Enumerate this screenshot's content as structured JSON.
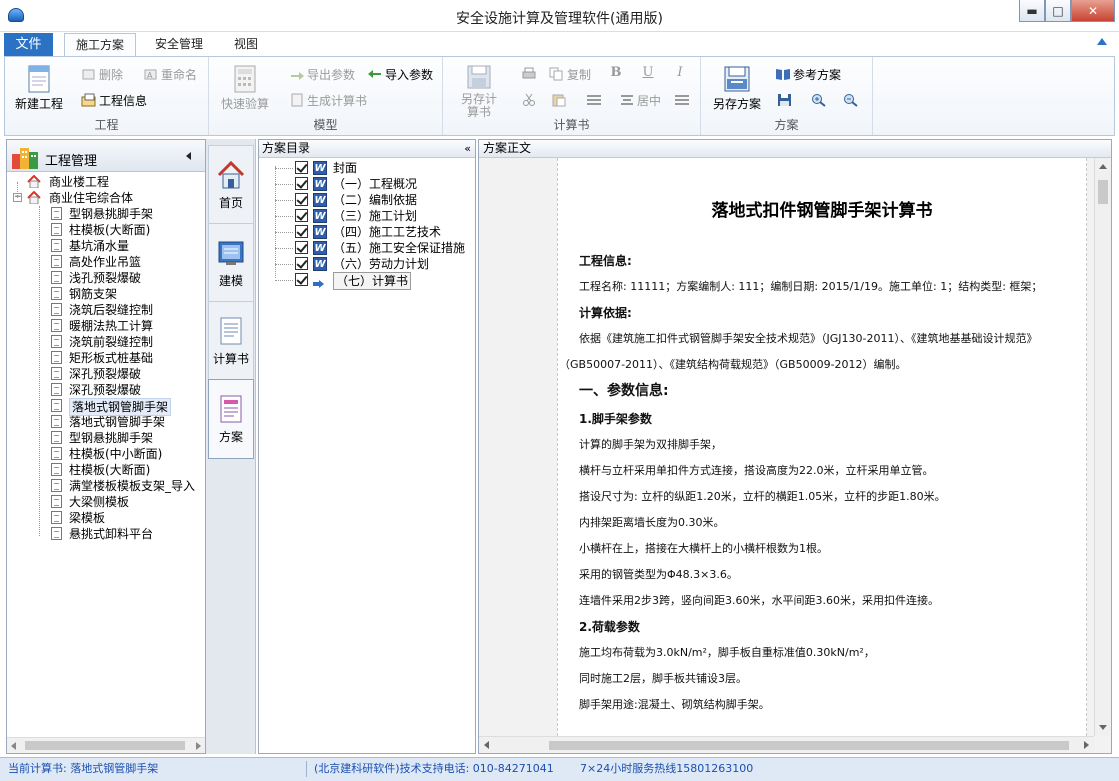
{
  "window": {
    "title": "安全设施计算及管理软件(通用版)",
    "min": "▬",
    "max": "□",
    "close": "✕"
  },
  "menu": {
    "file": "文件",
    "tabs": [
      "施工方案",
      "安全管理",
      "视图"
    ]
  },
  "ribbon": {
    "groups": {
      "project": "工程",
      "model": "模型",
      "calc": "计算书",
      "plan": "方案"
    },
    "new_project": "新建工程",
    "delete": "删除",
    "rename": "重命名",
    "project_info": "工程信息",
    "quick_check": "快速验算",
    "export_params": "导出参数",
    "import_params": "导入参数",
    "gen_calc": "生成计算书",
    "save_calc_as": "另存计算书",
    "copy": "复制",
    "bold": "B",
    "underline": "U",
    "italic": "I",
    "center": "居中",
    "save_plan_as": "另存方案",
    "ref_plan": "参考方案"
  },
  "left_panel": {
    "title": "工程管理",
    "projects": [
      {
        "name": "商业楼工程",
        "items": []
      },
      {
        "name": "商业住宅综合体",
        "items": [
          "型钢悬挑脚手架",
          "柱模板(大断面)",
          "基坑涌水量",
          "高处作业吊篮",
          "浅孔预裂爆破",
          "钢筋支架",
          "浇筑后裂缝控制",
          "暖棚法热工计算",
          "浇筑前裂缝控制",
          "矩形板式桩基础",
          "深孔预裂爆破",
          "深孔预裂爆破",
          "落地式钢管脚手架",
          "落地式钢管脚手架",
          "型钢悬挑脚手架",
          "柱模板(中小断面)",
          "柱模板(大断面)",
          "满堂楼板模板支架_导入",
          "大梁侧模板",
          "梁模板",
          "悬挑式卸料平台"
        ]
      }
    ],
    "selected_index": 12,
    "expand_sign": "−"
  },
  "nav": [
    "首页",
    "建模",
    "计算书",
    "方案"
  ],
  "catalog": {
    "title": "方案目录",
    "collapse": "«",
    "items": [
      "封面",
      "（一）工程概况",
      "（二）编制依据",
      "（三）施工计划",
      "（四）施工工艺技术",
      "（五）施工安全保证措施",
      "（六）劳动力计划",
      "（七）计算书"
    ],
    "word_glyph": "W"
  },
  "document": {
    "header": "方案正文",
    "title": "落地式扣件钢管脚手架计算书",
    "lines": [
      {
        "t": "工程信息:",
        "cls": "h"
      },
      {
        "t": "工程名称: 11111；方案编制人: 111；编制日期: 2015/1/19。施工单位: 1；结构类型: 框架；",
        "cls": "ind"
      },
      {
        "t": "计算依据:",
        "cls": "h"
      },
      {
        "t": "依据《建筑施工扣件式钢管脚手架安全技术规范》（JGJ130-2011）、《建筑地基基础设计规范》",
        "cls": "ind"
      },
      {
        "t": "（GB50007-2011）、《建筑结构荷载规范》（GB50009-2012）编制。",
        "cls": ""
      },
      {
        "t": "一、参数信息:",
        "cls": "h2"
      },
      {
        "t": "1.脚手架参数",
        "cls": "h"
      },
      {
        "t": "计算的脚手架为双排脚手架，",
        "cls": "ind"
      },
      {
        "t": "横杆与立杆采用单扣件方式连接，搭设高度为22.0米，立杆采用单立管。",
        "cls": "ind"
      },
      {
        "t": "搭设尺寸为: 立杆的纵距1.20米，立杆的横距1.05米，立杆的步距1.80米。",
        "cls": "ind"
      },
      {
        "t": "内排架距离墙长度为0.30米。",
        "cls": "ind"
      },
      {
        "t": "小横杆在上，搭接在大横杆上的小横杆根数为1根。",
        "cls": "ind"
      },
      {
        "t": "采用的钢管类型为Φ48.3×3.6。",
        "cls": "ind"
      },
      {
        "t": "连墙件采用2步3跨，竖向间距3.60米，水平间距3.60米，采用扣件连接。",
        "cls": "ind"
      },
      {
        "t": "2.荷载参数",
        "cls": "h"
      },
      {
        "t": "施工均布荷载为3.0kN/m²，脚手板自重标准值0.30kN/m²，",
        "cls": "ind"
      },
      {
        "t": "同时施工2层，脚手板共铺设3层。",
        "cls": "ind"
      },
      {
        "t": "脚手架用途:混凝土、砌筑结构脚手架。",
        "cls": "ind"
      }
    ]
  },
  "status": {
    "current_calc": "当前计算书: 落地式钢管脚手架",
    "support": "(北京建科研软件)技术支持电话: 010-84271041",
    "hotline": "7×24小时服务热线15801263100"
  }
}
